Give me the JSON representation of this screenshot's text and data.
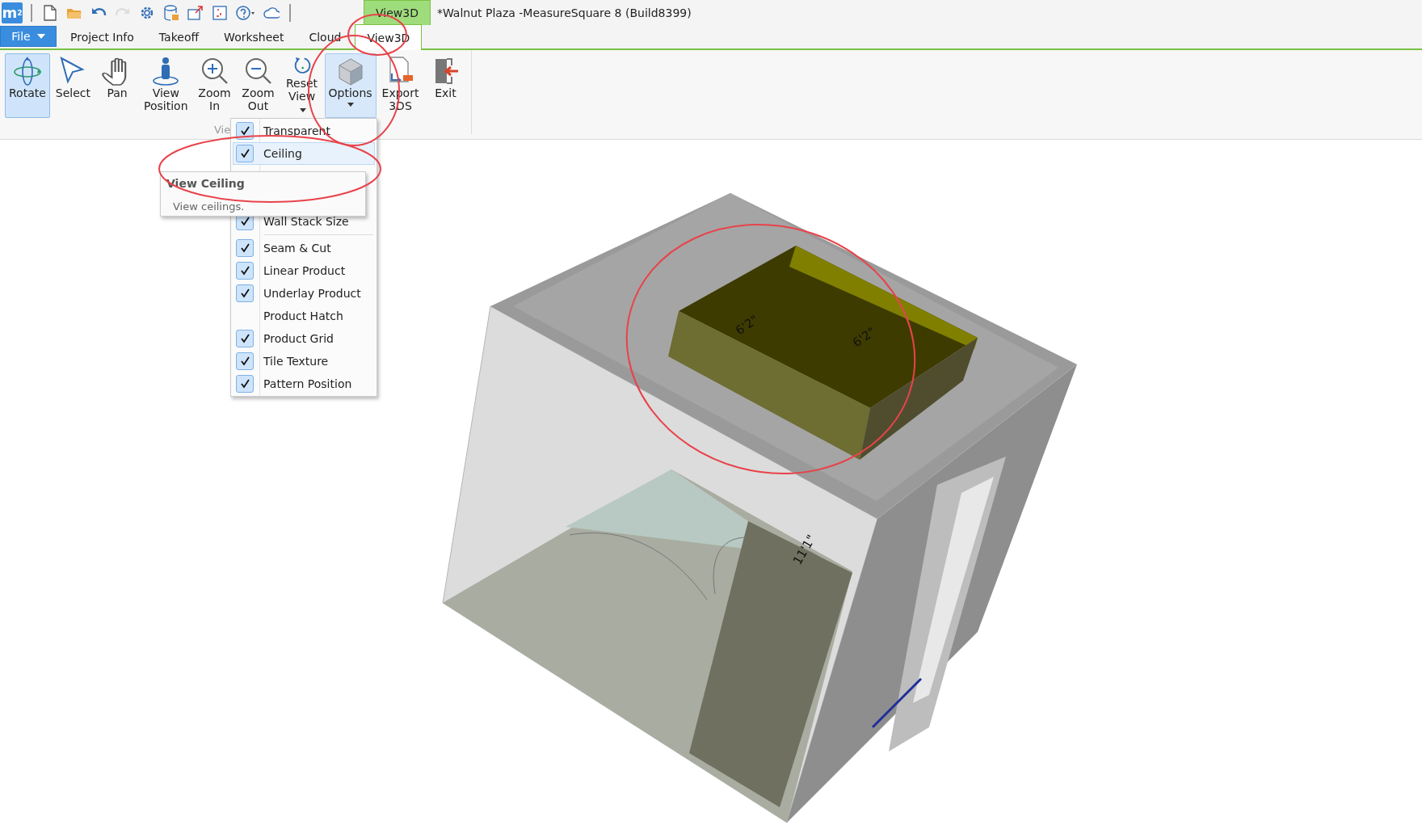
{
  "quick_access": {
    "logo": "m$^{2}$",
    "tools": [
      {
        "kind": "new",
        "disabled": false
      },
      {
        "kind": "open",
        "disabled": false
      },
      {
        "kind": "undo",
        "disabled": false
      },
      {
        "kind": "redo",
        "disabled": true
      },
      {
        "kind": "settings",
        "disabled": false
      },
      {
        "kind": "database",
        "disabled": false
      },
      {
        "kind": "export",
        "disabled": false
      },
      {
        "kind": "frame",
        "disabled": false
      },
      {
        "kind": "help",
        "disabled": false
      },
      {
        "kind": "cloud",
        "disabled": false
      }
    ]
  },
  "context_tab": "View3D",
  "title": "*Walnut Plaza -MeasureSquare 8 (Build8399)",
  "tabs": [
    {
      "label": "File",
      "kind": "file",
      "selected": false
    },
    {
      "label": "Project Info",
      "kind": "tab",
      "selected": false
    },
    {
      "label": "Takeoff",
      "kind": "tab",
      "selected": false
    },
    {
      "label": "Worksheet",
      "kind": "tab",
      "selected": false
    },
    {
      "label": "Cloud",
      "kind": "tab",
      "selected": false
    },
    {
      "label": "View3D",
      "kind": "tab",
      "selected": true
    }
  ],
  "ribbon": {
    "buttons": [
      {
        "label": "Rotate",
        "kind": "rotate",
        "selected": true,
        "expanded": false
      },
      {
        "label": "Select",
        "kind": "select",
        "selected": false,
        "expanded": false
      },
      {
        "label": "Pan",
        "kind": "pan",
        "selected": false,
        "expanded": false
      },
      {
        "label": "View Position",
        "kind": "position",
        "selected": false,
        "expanded": false
      },
      {
        "label": "Zoom In",
        "kind": "zoomin",
        "selected": false,
        "expanded": false
      },
      {
        "label": "Zoom Out",
        "kind": "zoomout",
        "selected": false,
        "expanded": false
      },
      {
        "label": "Reset View",
        "kind": "reset",
        "selected": false,
        "expanded": false,
        "caret_inline": true
      },
      {
        "label": "Options",
        "kind": "options",
        "selected": false,
        "expanded": true,
        "caret_below": true
      },
      {
        "label": "Export 3DS",
        "kind": "export3ds",
        "selected": false,
        "expanded": false
      },
      {
        "label": "Exit",
        "kind": "exit",
        "selected": false,
        "expanded": false
      }
    ],
    "group_label": "Vie"
  },
  "options_menu": {
    "items": [
      {
        "kind": "option",
        "label": "Transparent",
        "checked": true,
        "highlighted": false
      },
      {
        "kind": "option",
        "label": "Ceiling",
        "checked": true,
        "highlighted": true
      },
      {
        "kind": "covered"
      },
      {
        "kind": "covered"
      },
      {
        "kind": "option",
        "label": "Wall Stack Size",
        "checked": true,
        "highlighted": false
      },
      {
        "kind": "separator"
      },
      {
        "kind": "option",
        "label": "Seam & Cut",
        "checked": true,
        "highlighted": false
      },
      {
        "kind": "option",
        "label": "Linear Product",
        "checked": true,
        "highlighted": false
      },
      {
        "kind": "option",
        "label": "Underlay Product",
        "checked": true,
        "highlighted": false
      },
      {
        "kind": "option",
        "label": "Product Hatch",
        "checked": false,
        "highlighted": false
      },
      {
        "kind": "option",
        "label": "Product Grid",
        "checked": true,
        "highlighted": false
      },
      {
        "kind": "option",
        "label": "Tile Texture",
        "checked": true,
        "highlighted": false
      },
      {
        "kind": "option",
        "label": "Pattern Position",
        "checked": true,
        "highlighted": false
      }
    ]
  },
  "tooltip": {
    "title": "View Ceiling",
    "text": "View ceilings."
  },
  "view3d": {
    "dimension_labels": [
      "6'2\"",
      "6'2\"",
      "11'1\""
    ]
  }
}
